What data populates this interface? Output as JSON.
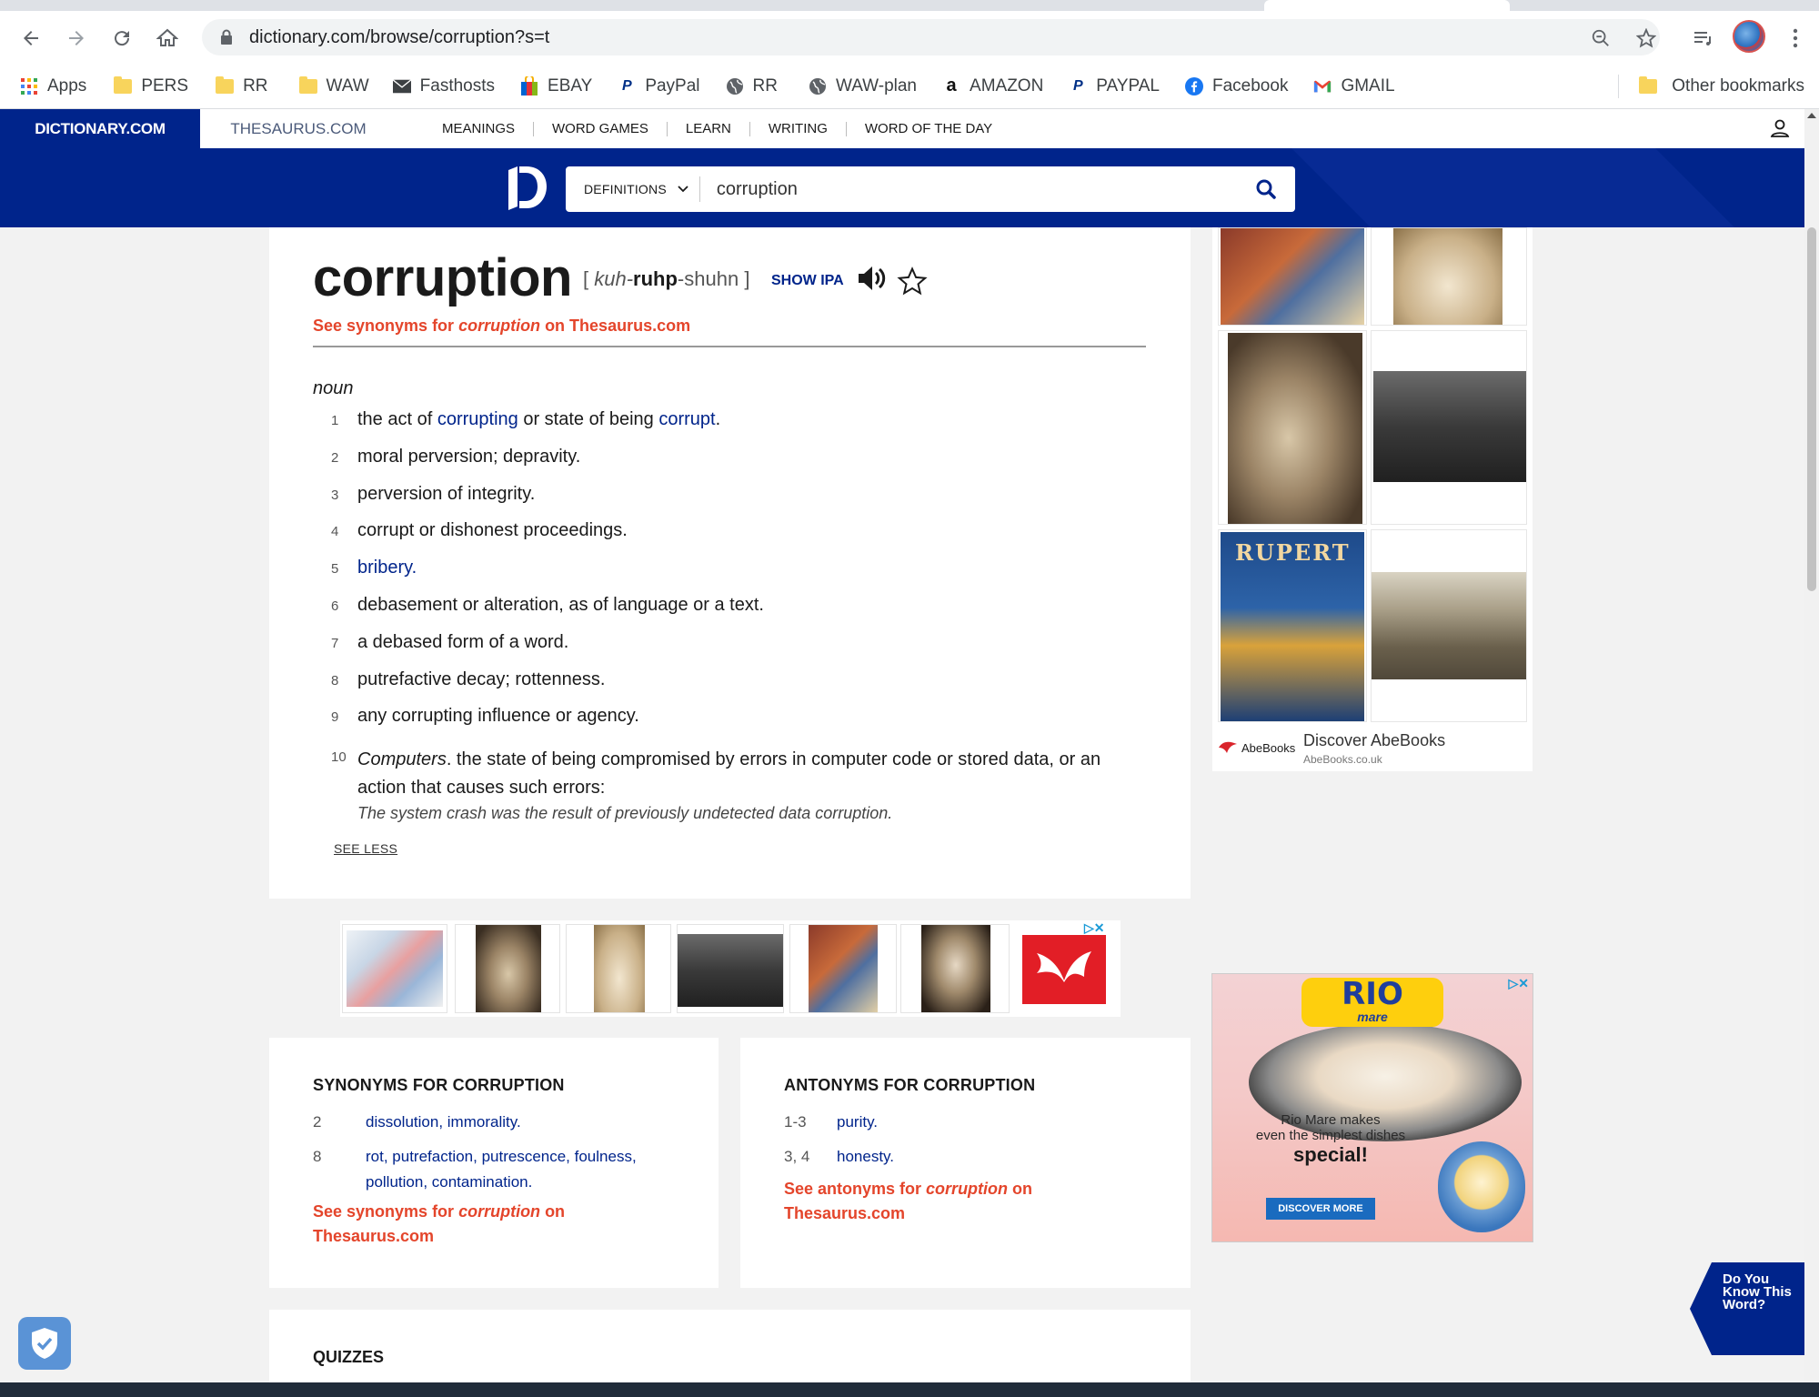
{
  "browser": {
    "url": "dictionary.com/browse/corruption?s=t",
    "bookmarks": [
      {
        "label": "Apps",
        "icon": "apps-grid-icon"
      },
      {
        "label": "PERS",
        "icon": "folder-icon"
      },
      {
        "label": "RR",
        "icon": "folder-icon"
      },
      {
        "label": "WAW",
        "icon": "folder-icon"
      },
      {
        "label": "Fasthosts",
        "icon": "mail-icon"
      },
      {
        "label": "EBAY",
        "icon": "shopping-bag-icon"
      },
      {
        "label": "PayPal",
        "icon": "paypal-icon"
      },
      {
        "label": "RR",
        "icon": "globe-icon"
      },
      {
        "label": "WAW-plan",
        "icon": "globe-icon"
      },
      {
        "label": "AMAZON",
        "icon": "amazon-icon"
      },
      {
        "label": "PAYPAL",
        "icon": "paypal-icon"
      },
      {
        "label": "Facebook",
        "icon": "facebook-icon"
      },
      {
        "label": "GMAIL",
        "icon": "gmail-icon"
      }
    ],
    "other_bookmarks": "Other bookmarks"
  },
  "site": {
    "brand": "DICTIONARY.COM",
    "thesaurus_tab": "THESAURUS.COM",
    "nav": [
      "MEANINGS",
      "WORD GAMES",
      "LEARN",
      "WRITING",
      "WORD OF THE DAY"
    ],
    "search_mode": "DEFINITIONS",
    "search_value": "corruption"
  },
  "entry": {
    "word": "corruption",
    "pron_open": "[ ",
    "pron_a": "kuh-",
    "pron_b": "ruhp",
    "pron_c": "-shuhn",
    "pron_close": " ]",
    "show_ipa": "SHOW IPA",
    "see_syn_a": "See synonyms for ",
    "see_syn_word": "corruption",
    "see_syn_b": " on Thesaurus.com",
    "pos": "noun",
    "def1_num": "1",
    "def1_a": "the act of ",
    "def1_link1": "corrupting",
    "def1_b": " or state of being ",
    "def1_link2": "corrupt",
    "def1_c": ".",
    "defs": [
      {
        "num": "2",
        "text": "moral perversion; depravity."
      },
      {
        "num": "3",
        "text": "perversion of integrity."
      },
      {
        "num": "4",
        "text": "corrupt or dishonest proceedings."
      }
    ],
    "def5_num": "5",
    "def5_link": "bribery",
    "def5_dot": ".",
    "defs2": [
      {
        "num": "6",
        "text": "debasement or alteration, as of language or a text."
      },
      {
        "num": "7",
        "text": "a debased form of a word."
      },
      {
        "num": "8",
        "text": "putrefactive decay; rottenness."
      },
      {
        "num": "9",
        "text": "any corrupting influence or agency."
      }
    ],
    "def10_num": "10",
    "def10_label": "Computers",
    "def10_text": ". the state of being compromised by errors in computer code or stored data, or an action that causes such errors:",
    "def10_example": "The system crash was the result of previously undetected data corruption.",
    "see_less": "SEE LESS"
  },
  "synonyms": {
    "title": "SYNONYMS FOR CORRUPTION",
    "row1_num": "2",
    "row1_words": "dissolution, immorality.",
    "row2_num": "8",
    "row2_words": "rot, putrefaction, putrescence, foulness, pollution, contamination.",
    "link_a": "See synonyms for ",
    "link_word": "corruption",
    "link_b": " on Thesaurus.com"
  },
  "antonyms": {
    "title": "ANTONYMS FOR CORRUPTION",
    "row1_num": "1-3",
    "row1_words": "purity.",
    "row2_num": "3, 4",
    "row2_words": "honesty.",
    "link_a": "See antonyms for ",
    "link_word": "corruption",
    "link_b": " on Thesaurus.com"
  },
  "quizzes": {
    "title": "QUIZZES"
  },
  "ads": {
    "abe_logo": "AbeBooks",
    "abe_title": "Discover AbeBooks",
    "abe_domain": "AbeBooks.co.uk",
    "rupert": "RUPERT",
    "ad_marks": "▷✕",
    "rio_logo_a": "RIO",
    "rio_logo_b": "mare",
    "rio_line1": "Rio Mare makes",
    "rio_line2": "even the simplest dishes",
    "rio_special": "special!",
    "rio_button": "DISCOVER MORE"
  },
  "dykw": "Do You Know This Word?",
  "colors": {
    "brand_blue": "#00248b",
    "accent_orange": "#e4452b",
    "link_blue": "#00248b"
  }
}
